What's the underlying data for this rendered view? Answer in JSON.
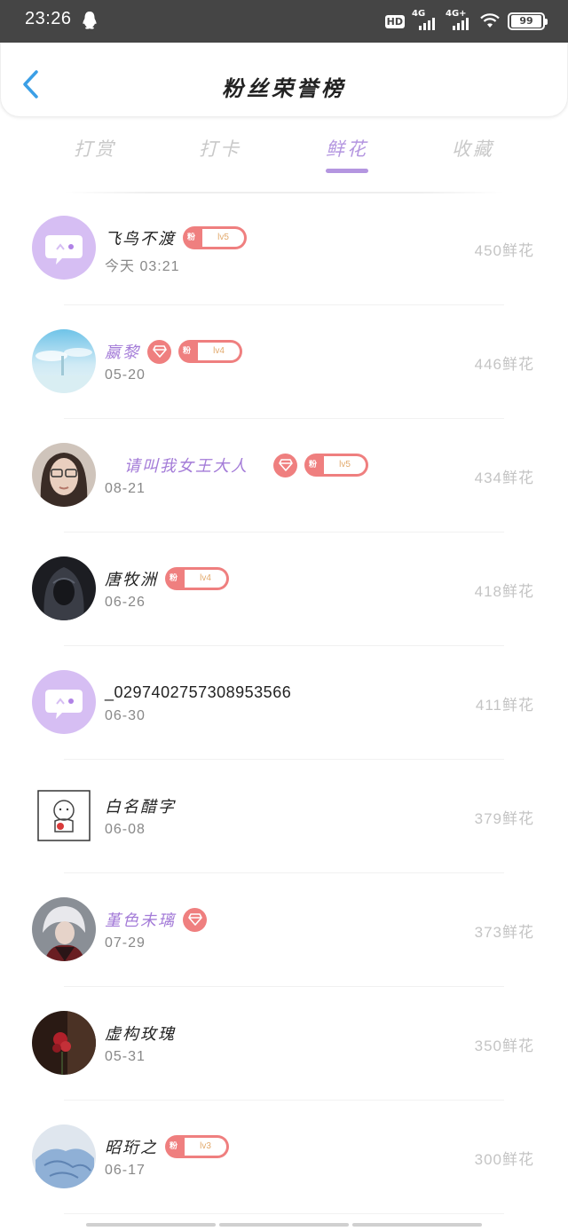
{
  "status_bar": {
    "time": "23:26",
    "hd_label": "HD",
    "sim1_label": "4G",
    "sim2_label": "4G+",
    "battery": "99"
  },
  "header": {
    "title": "粉丝荣誉榜"
  },
  "tabs": [
    {
      "label": "打赏",
      "active": false
    },
    {
      "label": "打卡",
      "active": false
    },
    {
      "label": "鲜花",
      "active": true
    },
    {
      "label": "收藏",
      "active": false
    }
  ],
  "colors": {
    "accent_purple": "#b496e0",
    "badge_red": "#ef7f7f",
    "vip_name": "#a47cd8"
  },
  "fans": [
    {
      "name": "飞鸟不渡",
      "date": "今天 03:21",
      "score": "450鲜花",
      "badge_level": "lv5",
      "diamond": false,
      "vip": false,
      "avatar": "default-avatar"
    },
    {
      "name": "嬴黎",
      "date": "05-20",
      "score": "446鲜花",
      "badge_level": "lv4",
      "diamond": true,
      "vip": true,
      "avatar": "sky-photo-avatar"
    },
    {
      "name": "请叫我女王大人",
      "date": "08-21",
      "score": "434鲜花",
      "badge_level": "lv5",
      "diamond": true,
      "vip": true,
      "avatar": "woman-glasses-avatar"
    },
    {
      "name": "唐牧洲",
      "date": "06-26",
      "score": "418鲜花",
      "badge_level": "lv4",
      "diamond": false,
      "vip": false,
      "avatar": "dark-hooded-avatar"
    },
    {
      "name": "_0297402757308953566",
      "date": "06-30",
      "score": "411鲜花",
      "badge_level": "",
      "diamond": false,
      "vip": false,
      "avatar": "default-avatar"
    },
    {
      "name": "白名醋字",
      "date": "06-08",
      "score": "379鲜花",
      "badge_level": "",
      "diamond": false,
      "vip": false,
      "avatar": "doodle-avatar"
    },
    {
      "name": "堇色未璃",
      "date": "07-29",
      "score": "373鲜花",
      "badge_level": "",
      "diamond": true,
      "vip": true,
      "avatar": "anime-boy-avatar"
    },
    {
      "name": "虚构玫瑰",
      "date": "05-31",
      "score": "350鲜花",
      "badge_level": "",
      "diamond": false,
      "vip": false,
      "avatar": "red-flower-avatar"
    },
    {
      "name": "昭珩之",
      "date": "06-17",
      "score": "300鲜花",
      "badge_level": "lv3",
      "diamond": false,
      "vip": false,
      "avatar": "blue-clothes-avatar"
    }
  ],
  "badge_prefix": "粉"
}
